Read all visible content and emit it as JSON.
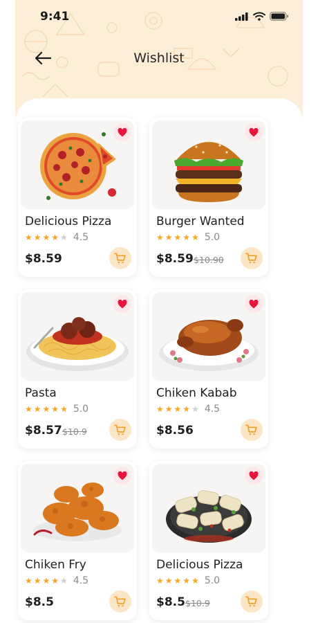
{
  "status_bar": {
    "time": "9:41"
  },
  "header": {
    "title": "Wishlist"
  },
  "colors": {
    "accent": "#f59a1b",
    "heart": "#e5163a",
    "star": "#f5a623",
    "background": "#fdeed8"
  },
  "items": [
    {
      "name": "Delicious Pizza",
      "rating": 4.5,
      "rating_text": "4.5",
      "price": "$8.59",
      "old_price": "",
      "image": "pizza"
    },
    {
      "name": "Burger Wanted",
      "rating": 5.0,
      "rating_text": "5.0",
      "price": "$8.59",
      "old_price": "$10.90",
      "image": "burger"
    },
    {
      "name": "Pasta",
      "rating": 5.0,
      "rating_text": "5.0",
      "price": "$8.57",
      "old_price": "$10.9",
      "image": "pasta"
    },
    {
      "name": "Chiken Kabab",
      "rating": 4.5,
      "rating_text": "4.5",
      "price": "$8.56",
      "old_price": "",
      "image": "chicken"
    },
    {
      "name": "Chiken Fry",
      "rating": 4.5,
      "rating_text": "4.5",
      "price": "$8.5",
      "old_price": "",
      "image": "fried-chicken"
    },
    {
      "name": "Delicious Pizza",
      "rating": 5.0,
      "rating_text": "5.0",
      "price": "$8.5",
      "old_price": "$10.9",
      "image": "wraps"
    }
  ]
}
